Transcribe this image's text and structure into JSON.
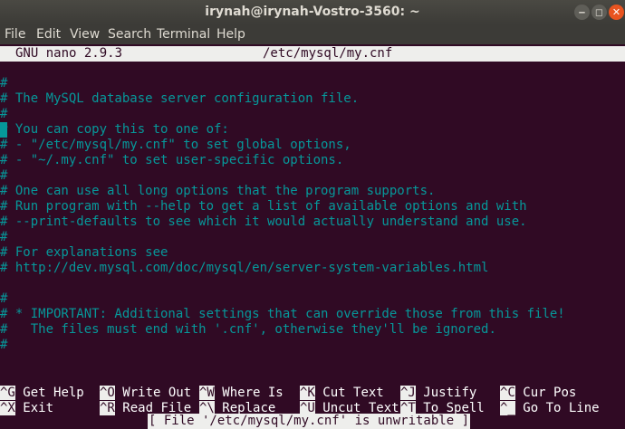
{
  "window": {
    "title": "irynah@irynah-Vostro-3560: ~",
    "minimize": "‒",
    "maximize": "◻",
    "close": "✕"
  },
  "menu": [
    "File",
    "Edit",
    "View",
    "Search",
    "Terminal",
    "Help"
  ],
  "nano": {
    "version": "GNU nano 2.9.3",
    "filename": "/etc/mysql/my.cnf",
    "lines": [
      "#",
      "# The MySQL database server configuration file.",
      "#",
      "# You can copy this to one of:",
      "# - \"/etc/mysql/my.cnf\" to set global options,",
      "# - \"~/.my.cnf\" to set user-specific options.",
      "#",
      "# One can use all long options that the program supports.",
      "# Run program with --help to get a list of available options and with",
      "# --print-defaults to see which it would actually understand and use.",
      "#",
      "# For explanations see",
      "# http://dev.mysql.com/doc/mysql/en/server-system-variables.html",
      "",
      "#",
      "# * IMPORTANT: Additional settings that can override those from this file!",
      "#   The files must end with '.cnf', otherwise they'll be ignored.",
      "#"
    ],
    "status_message": "[ File '/etc/mysql/my.cnf' is unwritable ]",
    "shortcuts": [
      [
        {
          "key": "^G",
          "label": "Get Help"
        },
        {
          "key": "^O",
          "label": "Write Out"
        },
        {
          "key": "^W",
          "label": "Where Is"
        },
        {
          "key": "^K",
          "label": "Cut Text"
        },
        {
          "key": "^J",
          "label": "Justify"
        },
        {
          "key": "^C",
          "label": "Cur Pos"
        }
      ],
      [
        {
          "key": "^X",
          "label": "Exit"
        },
        {
          "key": "^R",
          "label": "Read File"
        },
        {
          "key": "^\\",
          "label": "Replace"
        },
        {
          "key": "^U",
          "label": "Uncut Text"
        },
        {
          "key": "^T",
          "label": "To Spell"
        },
        {
          "key": "^_",
          "label": "Go To Line"
        }
      ]
    ]
  }
}
